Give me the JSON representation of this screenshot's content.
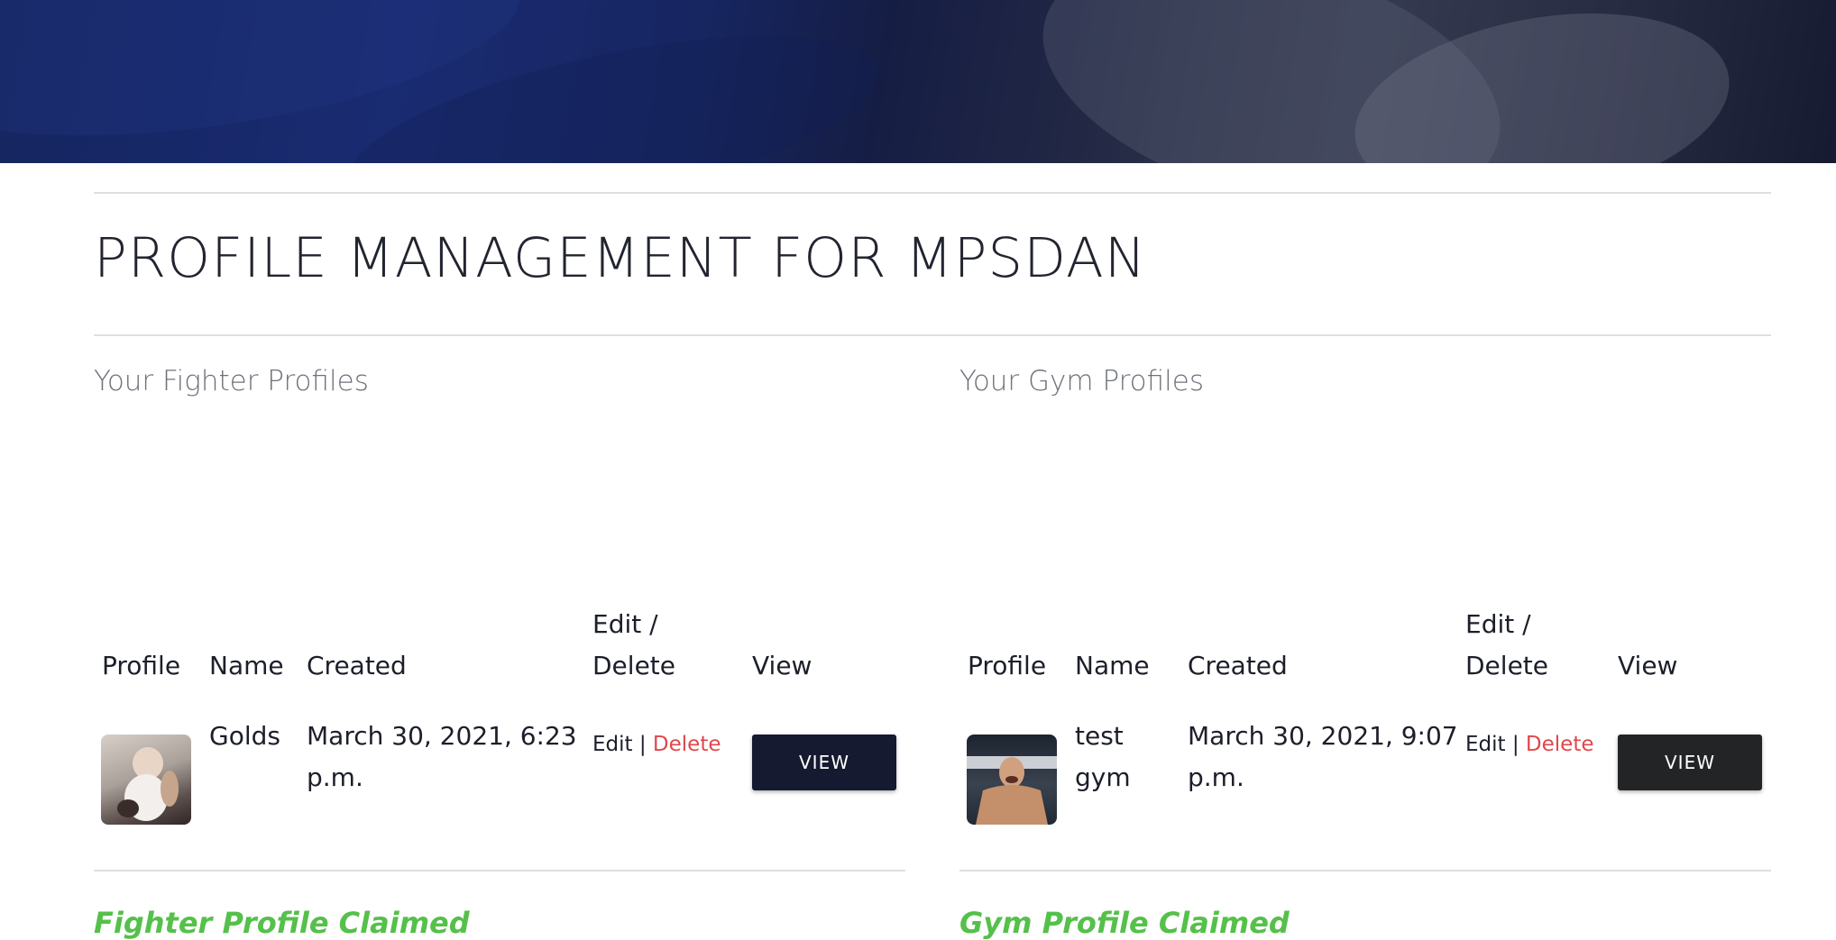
{
  "page_title": "PROFILE MANAGEMENT FOR MPSDAN",
  "colors": {
    "accent_dark": "#151a30",
    "delete_red": "#e0474c",
    "claimed_green": "#55c04a",
    "muted_heading": "#6e7179"
  },
  "fighter": {
    "title": "Your Fighter Profiles",
    "headers": {
      "profile": "Profile",
      "name": "Name",
      "created": "Created",
      "edit_line1": "Edit /",
      "edit_line2": "Delete",
      "view": "View"
    },
    "row": {
      "name": "Golds",
      "created_line1": "March 30, 2021, 6:23",
      "created_line2": "p.m.",
      "edit": "Edit",
      "separator": "|",
      "delete": "Delete",
      "view": "VIEW",
      "thumbnail_icon": "baby-photo-icon"
    },
    "claimed": "Fighter Profile Claimed"
  },
  "gym": {
    "title": "Your Gym Profiles",
    "headers": {
      "profile": "Profile",
      "name": "Name",
      "created": "Created",
      "edit_line1": "Edit /",
      "edit_line2": "Delete",
      "view": "View"
    },
    "row": {
      "name_line1": "test",
      "name_line2": "gym",
      "created_line1": "March 30, 2021, 9:07",
      "created_line2": "p.m.",
      "edit": "Edit",
      "separator": "|",
      "delete": "Delete",
      "view": "VIEW",
      "thumbnail_icon": "fighter-photo-icon"
    },
    "claimed": "Gym Profile Claimed"
  }
}
